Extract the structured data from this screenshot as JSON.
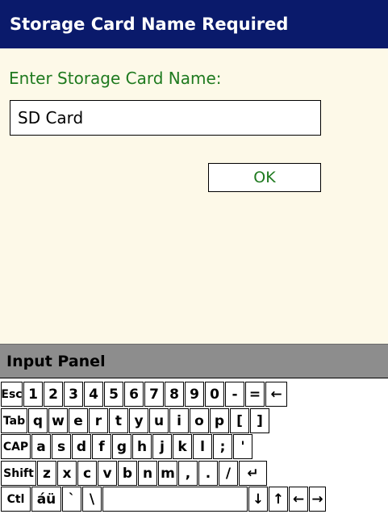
{
  "window": {
    "title": "Storage Card Name Required"
  },
  "dialog": {
    "prompt": "Enter Storage Card Name:",
    "card_name_value": "SD Card",
    "ok_label": "OK"
  },
  "input_panel": {
    "title": "Input Panel",
    "rows": [
      [
        "Esc",
        "1",
        "2",
        "3",
        "4",
        "5",
        "6",
        "7",
        "8",
        "9",
        "0",
        "-",
        "=",
        "←"
      ],
      [
        "Tab",
        "q",
        "w",
        "e",
        "r",
        "t",
        "y",
        "u",
        "i",
        "o",
        "p",
        "[",
        "]"
      ],
      [
        "CAP",
        "a",
        "s",
        "d",
        "f",
        "g",
        "h",
        "j",
        "k",
        "l",
        ";",
        "'"
      ],
      [
        "Shift",
        "z",
        "x",
        "c",
        "v",
        "b",
        "n",
        "m",
        ",",
        ".",
        "/",
        "↵"
      ],
      [
        "Ctl",
        "áü",
        "`",
        "\\",
        "",
        "↓",
        "↑",
        "←",
        "→"
      ]
    ]
  }
}
